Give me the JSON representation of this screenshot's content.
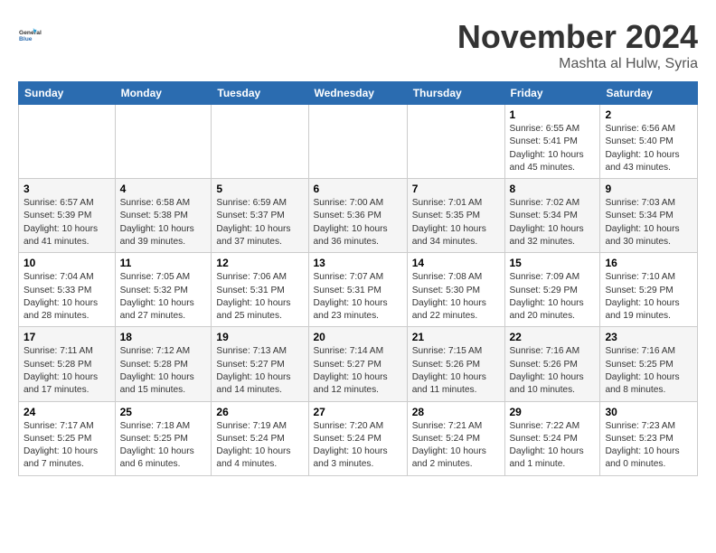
{
  "header": {
    "logo_line1": "General",
    "logo_line2": "Blue",
    "month": "November 2024",
    "location": "Mashta al Hulw, Syria"
  },
  "weekdays": [
    "Sunday",
    "Monday",
    "Tuesday",
    "Wednesday",
    "Thursday",
    "Friday",
    "Saturday"
  ],
  "weeks": [
    [
      {
        "day": "",
        "info": ""
      },
      {
        "day": "",
        "info": ""
      },
      {
        "day": "",
        "info": ""
      },
      {
        "day": "",
        "info": ""
      },
      {
        "day": "",
        "info": ""
      },
      {
        "day": "1",
        "info": "Sunrise: 6:55 AM\nSunset: 5:41 PM\nDaylight: 10 hours\nand 45 minutes."
      },
      {
        "day": "2",
        "info": "Sunrise: 6:56 AM\nSunset: 5:40 PM\nDaylight: 10 hours\nand 43 minutes."
      }
    ],
    [
      {
        "day": "3",
        "info": "Sunrise: 6:57 AM\nSunset: 5:39 PM\nDaylight: 10 hours\nand 41 minutes."
      },
      {
        "day": "4",
        "info": "Sunrise: 6:58 AM\nSunset: 5:38 PM\nDaylight: 10 hours\nand 39 minutes."
      },
      {
        "day": "5",
        "info": "Sunrise: 6:59 AM\nSunset: 5:37 PM\nDaylight: 10 hours\nand 37 minutes."
      },
      {
        "day": "6",
        "info": "Sunrise: 7:00 AM\nSunset: 5:36 PM\nDaylight: 10 hours\nand 36 minutes."
      },
      {
        "day": "7",
        "info": "Sunrise: 7:01 AM\nSunset: 5:35 PM\nDaylight: 10 hours\nand 34 minutes."
      },
      {
        "day": "8",
        "info": "Sunrise: 7:02 AM\nSunset: 5:34 PM\nDaylight: 10 hours\nand 32 minutes."
      },
      {
        "day": "9",
        "info": "Sunrise: 7:03 AM\nSunset: 5:34 PM\nDaylight: 10 hours\nand 30 minutes."
      }
    ],
    [
      {
        "day": "10",
        "info": "Sunrise: 7:04 AM\nSunset: 5:33 PM\nDaylight: 10 hours\nand 28 minutes."
      },
      {
        "day": "11",
        "info": "Sunrise: 7:05 AM\nSunset: 5:32 PM\nDaylight: 10 hours\nand 27 minutes."
      },
      {
        "day": "12",
        "info": "Sunrise: 7:06 AM\nSunset: 5:31 PM\nDaylight: 10 hours\nand 25 minutes."
      },
      {
        "day": "13",
        "info": "Sunrise: 7:07 AM\nSunset: 5:31 PM\nDaylight: 10 hours\nand 23 minutes."
      },
      {
        "day": "14",
        "info": "Sunrise: 7:08 AM\nSunset: 5:30 PM\nDaylight: 10 hours\nand 22 minutes."
      },
      {
        "day": "15",
        "info": "Sunrise: 7:09 AM\nSunset: 5:29 PM\nDaylight: 10 hours\nand 20 minutes."
      },
      {
        "day": "16",
        "info": "Sunrise: 7:10 AM\nSunset: 5:29 PM\nDaylight: 10 hours\nand 19 minutes."
      }
    ],
    [
      {
        "day": "17",
        "info": "Sunrise: 7:11 AM\nSunset: 5:28 PM\nDaylight: 10 hours\nand 17 minutes."
      },
      {
        "day": "18",
        "info": "Sunrise: 7:12 AM\nSunset: 5:28 PM\nDaylight: 10 hours\nand 15 minutes."
      },
      {
        "day": "19",
        "info": "Sunrise: 7:13 AM\nSunset: 5:27 PM\nDaylight: 10 hours\nand 14 minutes."
      },
      {
        "day": "20",
        "info": "Sunrise: 7:14 AM\nSunset: 5:27 PM\nDaylight: 10 hours\nand 12 minutes."
      },
      {
        "day": "21",
        "info": "Sunrise: 7:15 AM\nSunset: 5:26 PM\nDaylight: 10 hours\nand 11 minutes."
      },
      {
        "day": "22",
        "info": "Sunrise: 7:16 AM\nSunset: 5:26 PM\nDaylight: 10 hours\nand 10 minutes."
      },
      {
        "day": "23",
        "info": "Sunrise: 7:16 AM\nSunset: 5:25 PM\nDaylight: 10 hours\nand 8 minutes."
      }
    ],
    [
      {
        "day": "24",
        "info": "Sunrise: 7:17 AM\nSunset: 5:25 PM\nDaylight: 10 hours\nand 7 minutes."
      },
      {
        "day": "25",
        "info": "Sunrise: 7:18 AM\nSunset: 5:25 PM\nDaylight: 10 hours\nand 6 minutes."
      },
      {
        "day": "26",
        "info": "Sunrise: 7:19 AM\nSunset: 5:24 PM\nDaylight: 10 hours\nand 4 minutes."
      },
      {
        "day": "27",
        "info": "Sunrise: 7:20 AM\nSunset: 5:24 PM\nDaylight: 10 hours\nand 3 minutes."
      },
      {
        "day": "28",
        "info": "Sunrise: 7:21 AM\nSunset: 5:24 PM\nDaylight: 10 hours\nand 2 minutes."
      },
      {
        "day": "29",
        "info": "Sunrise: 7:22 AM\nSunset: 5:24 PM\nDaylight: 10 hours\nand 1 minute."
      },
      {
        "day": "30",
        "info": "Sunrise: 7:23 AM\nSunset: 5:23 PM\nDaylight: 10 hours\nand 0 minutes."
      }
    ]
  ]
}
